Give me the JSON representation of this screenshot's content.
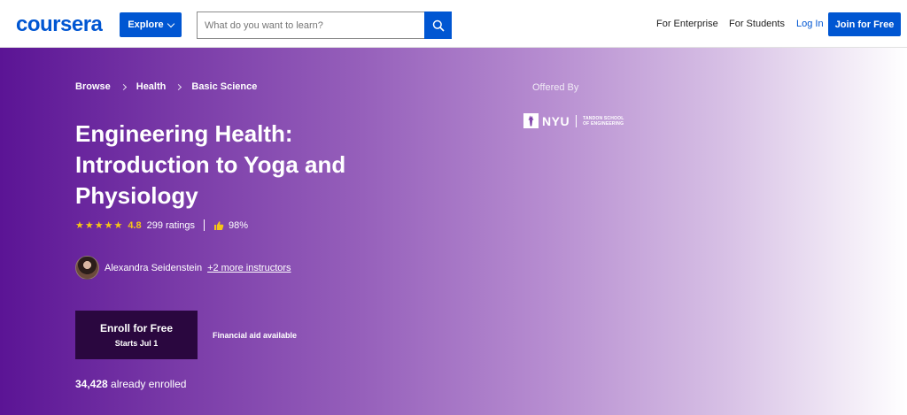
{
  "header": {
    "logo": "coursera",
    "explore_label": "Explore",
    "search_placeholder": "What do you want to learn?",
    "for_enterprise": "For Enterprise",
    "for_students": "For Students",
    "login": "Log In",
    "join": "Join for Free"
  },
  "breadcrumb": [
    "Browse",
    "Health",
    "Basic Science"
  ],
  "course": {
    "title": "Engineering Health: Introduction to Yoga and Physiology",
    "rating": "4.8",
    "ratings_count": "299 ratings",
    "approval": "98%",
    "instructor": "Alexandra Seidenstein",
    "more_instructors": "+2 more instructors",
    "enroll_label": "Enroll for Free",
    "starts": "Starts Jul 1",
    "financial_aid": "Financial aid available",
    "enrolled_count": "34,428",
    "enrolled_text": "already enrolled"
  },
  "offered_by": {
    "label": "Offered By",
    "org_mark": "NYU",
    "org_line1": "TANDON SCHOOL",
    "org_line2": "OF ENGINEERING"
  },
  "colors": {
    "brand": "#0056d2",
    "hero_start": "#5b1495",
    "enroll_bg": "#2a073f",
    "star": "#f5c518"
  }
}
